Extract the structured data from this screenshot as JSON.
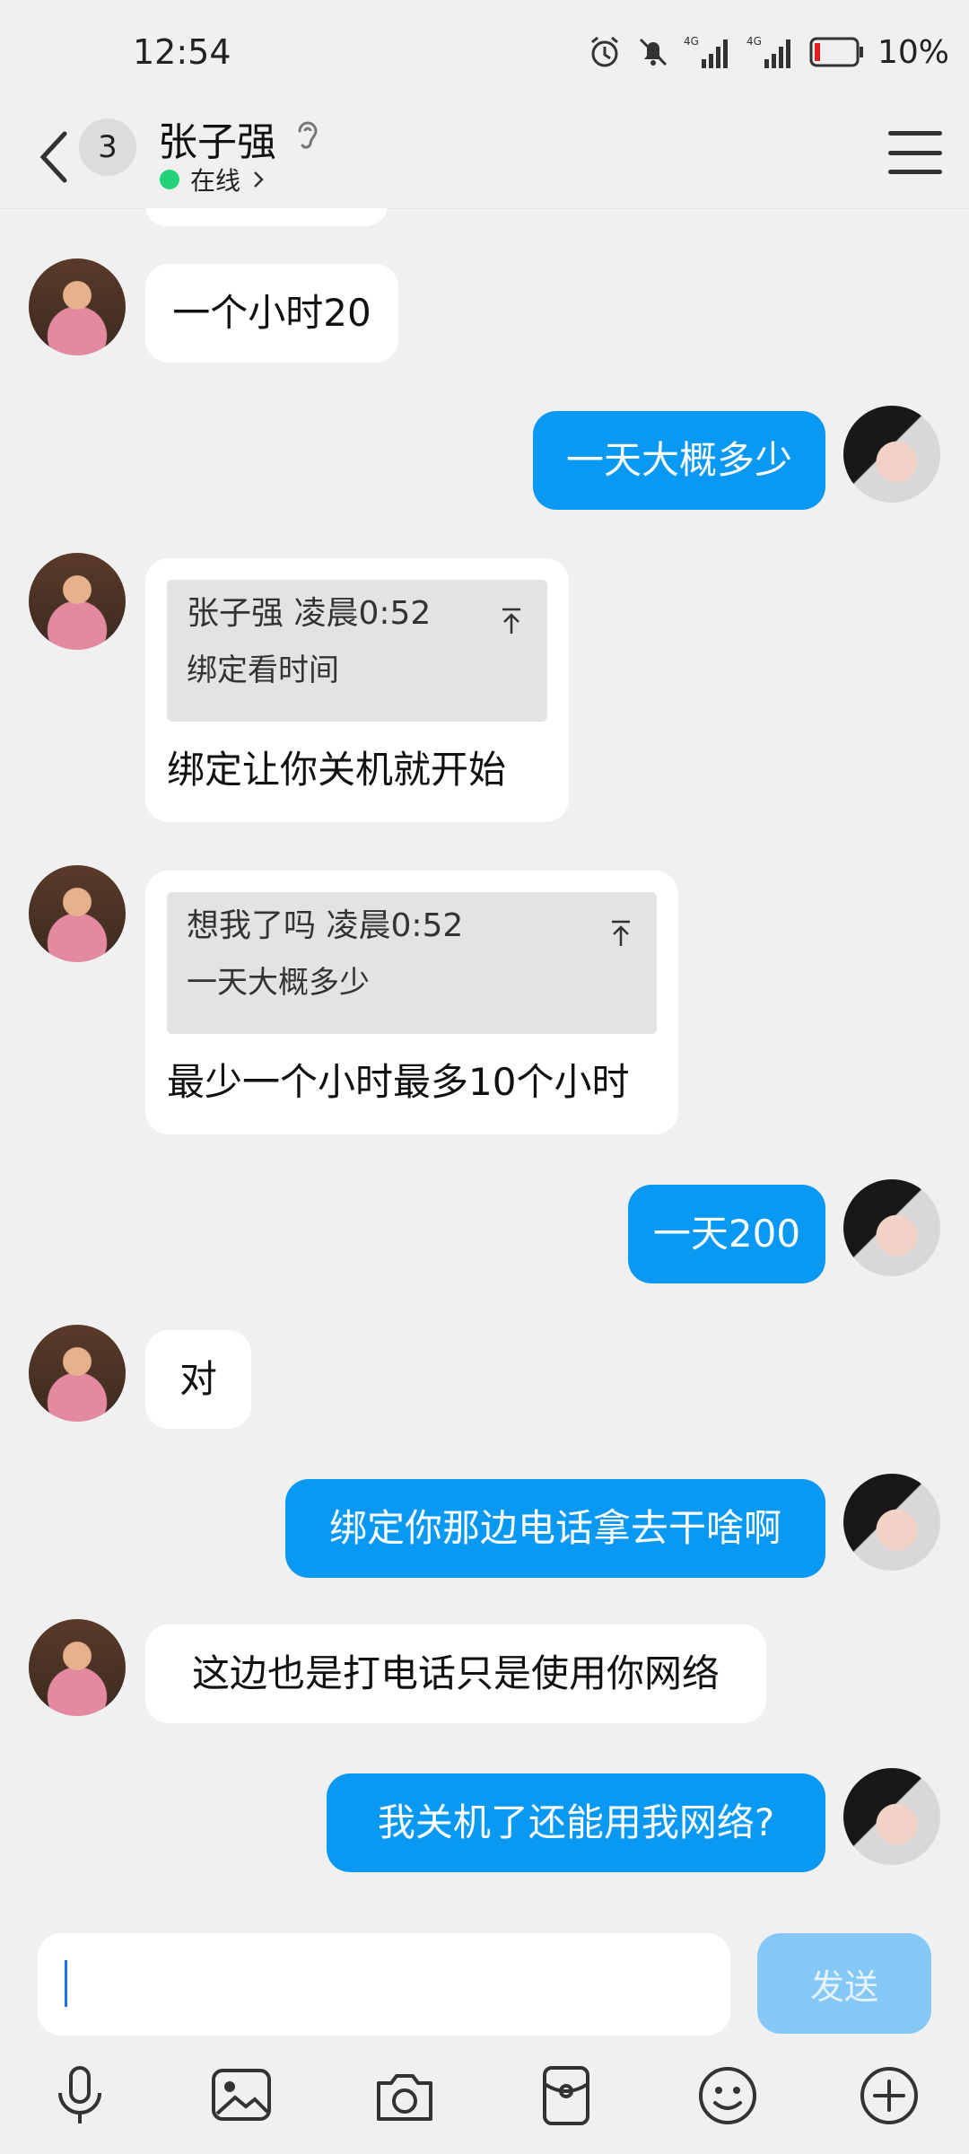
{
  "status_bar": {
    "time": "12:54",
    "signal_1_label": "4G",
    "signal_2_label": "4G",
    "battery": "10%",
    "icons": [
      "alarm-icon",
      "mute-icon",
      "signal-icon",
      "signal-icon",
      "battery-icon"
    ]
  },
  "header": {
    "back_icon": "chevron-left-icon",
    "unread_count": "3",
    "contact_name": "张子强",
    "ear_icon": "ear-icon",
    "status": "在线",
    "status_chevron": "chevron-right-icon",
    "menu_icon": "menu-icon"
  },
  "messages": [
    {
      "side": "in",
      "text": "一个小时20"
    },
    {
      "side": "out",
      "text": "一天大概多少"
    },
    {
      "side": "in",
      "quote_author_time": "张子强 凌晨0:52",
      "quote_text": "绑定看时间",
      "text": "绑定让你关机就开始"
    },
    {
      "side": "in",
      "quote_author_time": "想我了吗 凌晨0:52",
      "quote_text": "一天大概多少",
      "text": "最少一个小时最多10个小时"
    },
    {
      "side": "out",
      "text": "一天200"
    },
    {
      "side": "in",
      "text": "对"
    },
    {
      "side": "out",
      "text": "绑定你那边电话拿去干啥啊"
    },
    {
      "side": "in",
      "text": "这边也是打电话只是使用你网络"
    },
    {
      "side": "out",
      "text": "我关机了还能用我网络?"
    }
  ],
  "input": {
    "value": "",
    "placeholder": "",
    "send_label": "发送"
  },
  "toolbar": {
    "items": [
      "microphone-icon",
      "image-icon",
      "camera-icon",
      "red-packet-icon",
      "emoji-icon",
      "plus-icon"
    ]
  },
  "colors": {
    "outgoing_bubble": "#0a99f2",
    "incoming_bubble": "#ffffff",
    "background": "#f0f0f0",
    "send_button": "#86c8f5",
    "online_dot": "#22d37a"
  }
}
